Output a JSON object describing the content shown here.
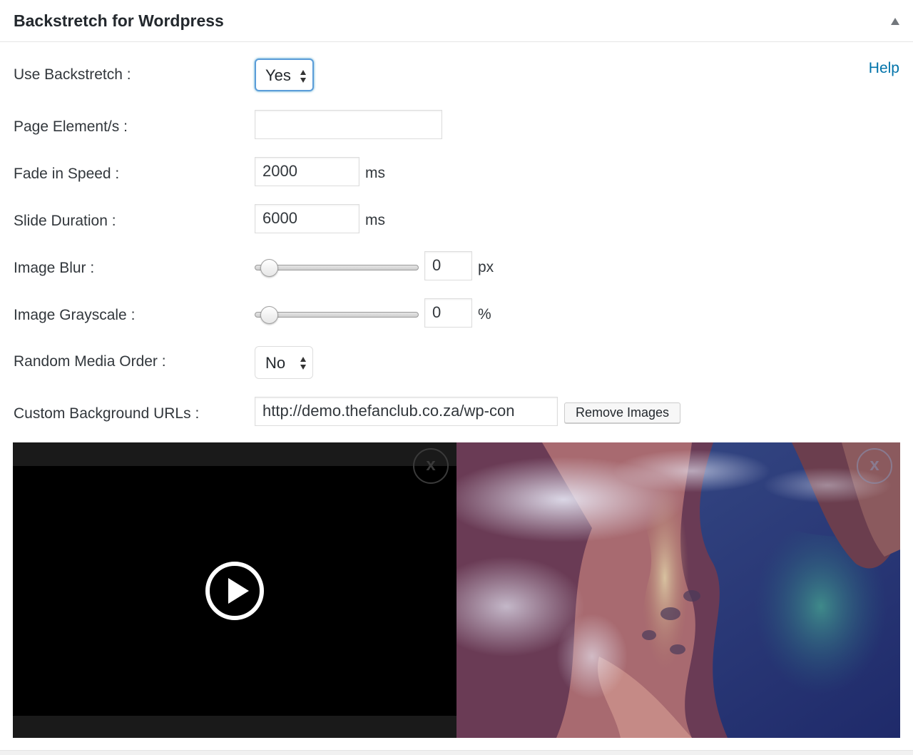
{
  "panel": {
    "title": "Backstretch for Wordpress",
    "help_label": "Help"
  },
  "fields": {
    "use_backstretch": {
      "label": "Use Backstretch :",
      "value": "Yes"
    },
    "page_elements": {
      "label": "Page Element/s :",
      "value": ""
    },
    "fade_in_speed": {
      "label": "Fade in Speed :",
      "value": "2000",
      "unit": "ms"
    },
    "slide_duration": {
      "label": "Slide Duration :",
      "value": "6000",
      "unit": "ms"
    },
    "image_blur": {
      "label": "Image Blur :",
      "value": "0",
      "unit": "px",
      "slider_level": 0
    },
    "image_grayscale": {
      "label": "Image Grayscale :",
      "value": "0",
      "unit": "%",
      "slider_level": 0
    },
    "random_media_order": {
      "label": "Random Media Order :",
      "value": "No"
    },
    "custom_background_urls": {
      "label": "Custom Background URLs :",
      "value": "http://demo.thefanclub.co.za/wp-con",
      "remove_label": "Remove Images"
    }
  },
  "media": {
    "items": [
      {
        "type": "video",
        "icon": "play-icon",
        "remove_glyph": "x"
      },
      {
        "type": "image",
        "icon": "remove-icon",
        "remove_glyph": "x"
      }
    ]
  },
  "colors": {
    "link": "#0073aa",
    "focus_ring": "#5b9dd9",
    "video_background": "#000000"
  }
}
